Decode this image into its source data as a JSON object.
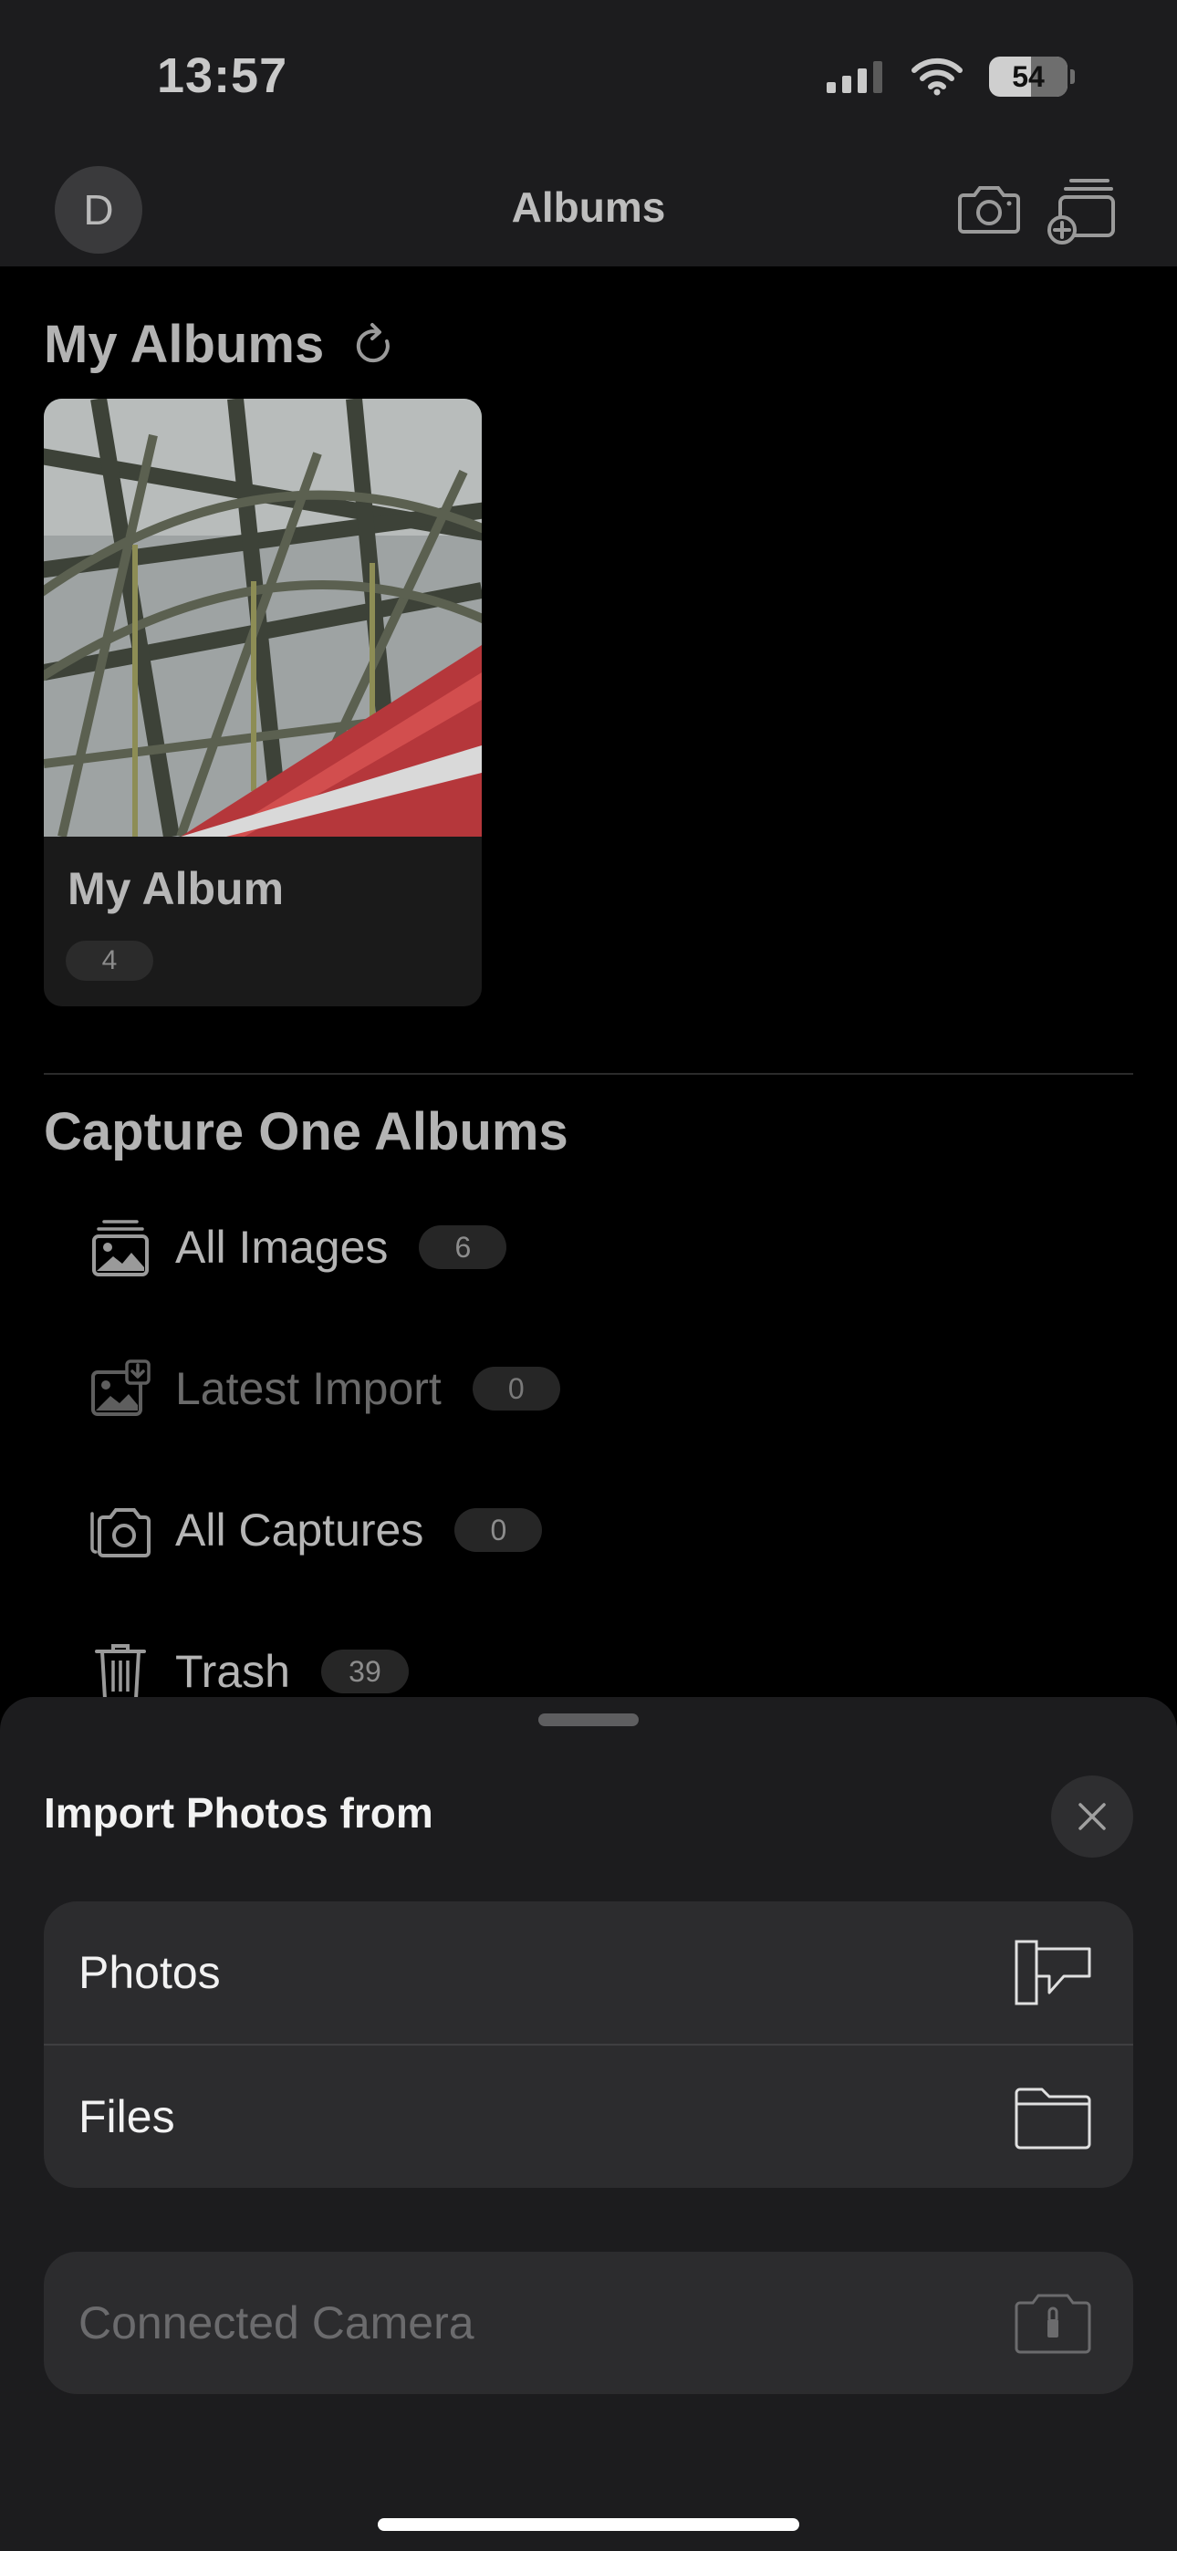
{
  "status_bar": {
    "time": "13:57",
    "battery": "54",
    "icons": [
      "cellular-signal-icon",
      "wifi-icon",
      "battery-icon"
    ]
  },
  "nav": {
    "avatar_initial": "D",
    "title": "Albums",
    "icons": [
      "camera-icon",
      "add-album-icon"
    ]
  },
  "my_albums": {
    "title": "My Albums",
    "albums": [
      {
        "name": "My Album",
        "count": "4"
      }
    ]
  },
  "capture_one_albums": {
    "title": "Capture One Albums",
    "items": [
      {
        "label": "All Images",
        "count": "6",
        "icon": "images-icon",
        "enabled": true
      },
      {
        "label": "Latest Import",
        "count": "0",
        "icon": "import-icon",
        "enabled": false
      },
      {
        "label": "All Captures",
        "count": "0",
        "icon": "captures-icon",
        "enabled": true
      },
      {
        "label": "Trash",
        "count": "39",
        "icon": "trash-icon",
        "enabled": true
      }
    ]
  },
  "import_sheet": {
    "title": "Import Photos from",
    "options": [
      {
        "label": "Photos",
        "icon": "photos-source-icon"
      },
      {
        "label": "Files",
        "icon": "folder-icon"
      }
    ],
    "connected_camera": {
      "label": "Connected Camera",
      "icon": "connected-camera-icon",
      "enabled": false
    }
  },
  "colors": {
    "background": "#000000",
    "bar": "#1c1c1e",
    "sheet_option": "#2c2c2e"
  }
}
